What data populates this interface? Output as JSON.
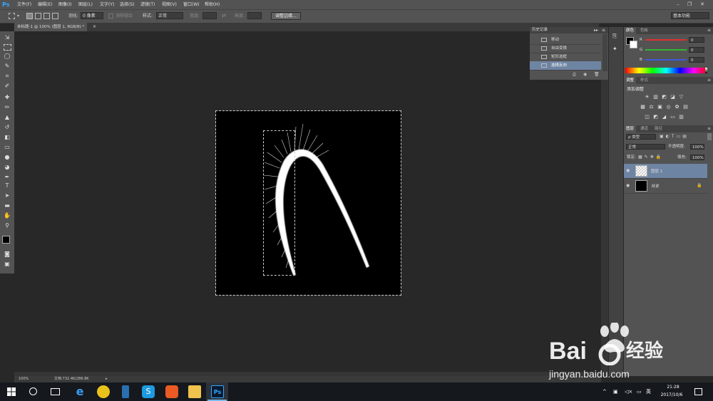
{
  "app": {
    "logo": "Ps"
  },
  "menu": [
    "文件(F)",
    "编辑(E)",
    "图像(I)",
    "图层(L)",
    "文字(Y)",
    "选择(S)",
    "滤镜(T)",
    "视图(V)",
    "窗口(W)",
    "帮助(H)"
  ],
  "options": {
    "feather_label": "羽化:",
    "feather_value": "0 像素",
    "antialias_label": "消除锯齿",
    "style_label": "样式:",
    "style_value": "正常",
    "width_label": "宽度:",
    "height_label": "高度:",
    "refine_button": "调整边缘...",
    "workspace": "基本功能"
  },
  "document": {
    "tab_title": "未标题-1 @ 100% (图层 1, RGB/8) *"
  },
  "status": {
    "zoom": "100%",
    "doc_size": "文档:732.4K/286.8K"
  },
  "history": {
    "title": "历史记录",
    "items": [
      "移动",
      "自由变换",
      "矩形选框",
      "选择反向"
    ],
    "active_index": 3
  },
  "color_panel": {
    "tabs": [
      "颜色",
      "色板"
    ],
    "channels": [
      {
        "name": "R",
        "value": "0",
        "color": "#e23030"
      },
      {
        "name": "G",
        "value": "0",
        "color": "#2fb52f"
      },
      {
        "name": "B",
        "value": "0",
        "color": "#3b5bd9"
      }
    ]
  },
  "adjustments": {
    "tabs": [
      "调整",
      "样式"
    ],
    "heading": "添加调整"
  },
  "layers": {
    "tabs": [
      "图层",
      "通道",
      "路径"
    ],
    "filter_label": "ρ 类型",
    "blend_mode": "正常",
    "opacity_label": "不透明度:",
    "opacity_value": "100%",
    "lock_label": "锁定:",
    "fill_label": "填充:",
    "fill_value": "100%",
    "items": [
      {
        "name": "图层 1",
        "selected": true
      },
      {
        "name": "背景",
        "selected": false
      }
    ]
  },
  "taskbar": {
    "time": "21:28",
    "date": "2017/10/6",
    "ime": "英"
  },
  "watermark": {
    "brand": "Bai",
    "brand2": "经验",
    "url": "jingyan.baidu.com"
  }
}
